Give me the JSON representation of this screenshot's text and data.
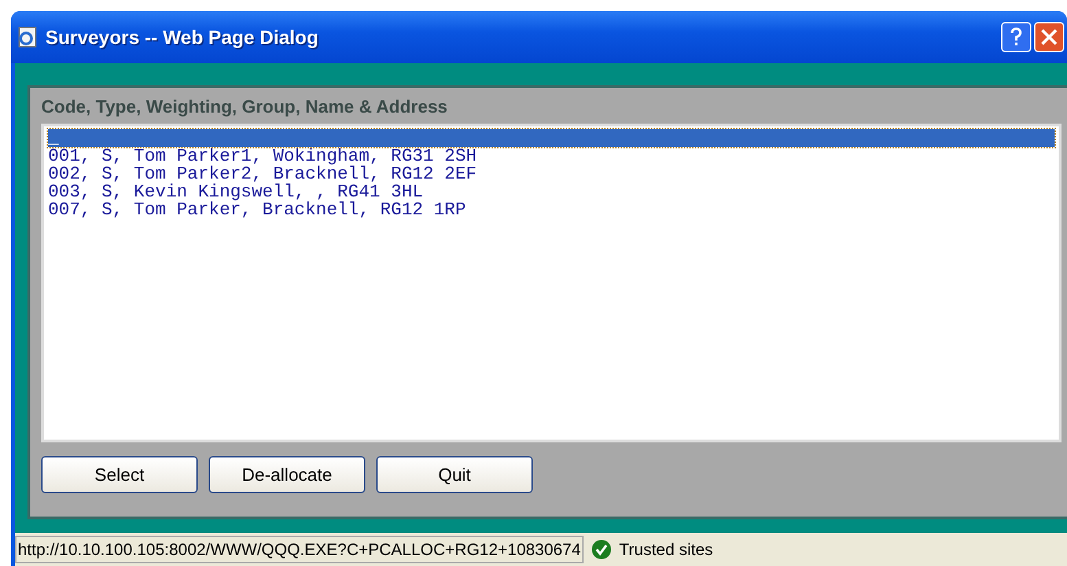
{
  "window": {
    "title": "Surveyors -- Web Page Dialog"
  },
  "list": {
    "label": "Code, Type, Weighting, Group, Name & Address",
    "items": [
      {
        "text": "_",
        "selected": true
      },
      {
        "text": "001, S, Tom Parker1, Wokingham, RG31 2SH",
        "selected": false
      },
      {
        "text": "002, S, Tom Parker2, Bracknell, RG12 2EF",
        "selected": false
      },
      {
        "text": "003, S, Kevin Kingswell, , RG41 3HL",
        "selected": false
      },
      {
        "text": "007, S, Tom Parker, Bracknell, RG12 1RP",
        "selected": false
      }
    ]
  },
  "buttons": [
    "Select",
    "De-allocate",
    "Quit"
  ],
  "status_bar": {
    "url": "http://10.10.100.105:8002/WWW/QQQ.EXE?C+PCALLOC+RG12+10830674",
    "zone": "Trusted sites"
  }
}
